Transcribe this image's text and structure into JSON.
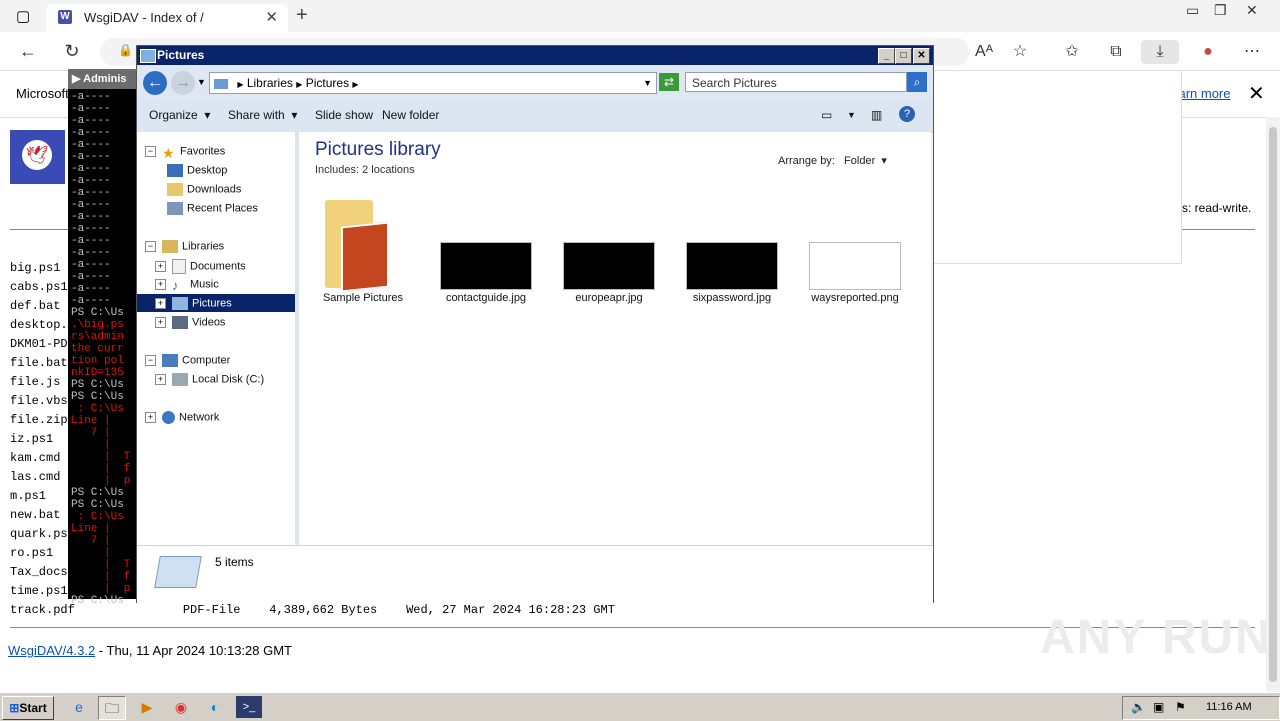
{
  "browser": {
    "tab_title": "WsgiDAV - Index of /",
    "tab_favicon": "W",
    "address_lock": "🔒"
  },
  "infobar": {
    "text": "Microsoft",
    "learn_more": "Learn more"
  },
  "page": {
    "files": [
      "big.ps1",
      "cabs.ps1",
      "def.bat",
      "desktop.",
      "DKM01-PD",
      "file.bat",
      "file.js",
      "file.vbs",
      "file.zip",
      "iz.ps1",
      "kam.cmd",
      "las.cmd",
      "m.ps1",
      "new.bat",
      "quark.ps",
      "ro.ps1",
      "Tax_docs",
      "time.ps1"
    ],
    "track_row": "track.pdf               PDF-File    4,389,662 Bytes    Wed, 27 Mar 2024 16:28:23 GMT",
    "rw_text": "s: read-write.",
    "footer_link": "WsgiDAV/4.3.2",
    "footer_text": " - Thu, 11 Apr 2024 10:13:28 GMT",
    "watermark": "ANY RUN"
  },
  "console": {
    "title": "Adminis",
    "lines_white_1": "-a----\n-a----\n-a----\n-a----\n-a----\n-a----\n-a----\n-a----\n-a----\n-a----\n-a----\n-a----\n-a----\n-a----\n-a----\n-a----\n-a----\n-a----",
    "ps1": "PS C:\\Us",
    "red1": ".\\big.ps\nrs\\admin\nthe curr\ntion pol\nnkID=135",
    "ps2": "PS C:\\Us\nPS C:\\Us",
    "red2": " : C:\\Us\nLine |\n   7 |\n     |\n     |  T\n     |  f\n     |  p",
    "ps3": "PS C:\\Us\nPS C:\\Us",
    "red3": " : C:\\Us\nLine |\n   7 |\n     |\n     |  T\n     |  f\n     |  p",
    "ps4": "PS C:\\Us"
  },
  "explorer": {
    "title": "Pictures",
    "breadcrumb": [
      "Libraries",
      "Pictures"
    ],
    "search_placeholder": "Search Pictures",
    "toolbar": {
      "organize": "Organize",
      "share_with": "Share with",
      "slide_show": "Slide show",
      "new_folder": "New folder"
    },
    "nav": {
      "favorites": "Favorites",
      "desktop": "Desktop",
      "downloads": "Downloads",
      "recent_places": "Recent Places",
      "libraries": "Libraries",
      "documents": "Documents",
      "music": "Music",
      "pictures": "Pictures",
      "videos": "Videos",
      "computer": "Computer",
      "local_disk": "Local Disk (C:)",
      "network": "Network"
    },
    "library_title": "Pictures library",
    "includes": "Includes:  2 locations",
    "arrange_by_label": "Arrange by:",
    "arrange_by_value": "Folder",
    "items": [
      {
        "name": "Sample Pictures"
      },
      {
        "name": "contactguide.jpg"
      },
      {
        "name": "europeapr.jpg"
      },
      {
        "name": "sixpassword.jpg"
      },
      {
        "name": "waysreported.png"
      }
    ],
    "status": "5 items"
  },
  "taskbar": {
    "start": "Start",
    "clock": "11:16 AM"
  }
}
